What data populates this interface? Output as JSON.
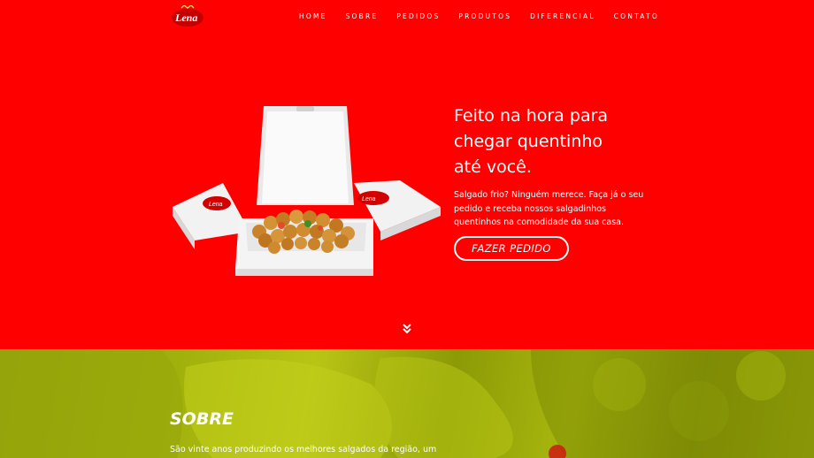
{
  "brand": {
    "logo_text": "Lena",
    "colors": {
      "primary": "#ff0000",
      "olive": "#a1b10c"
    }
  },
  "nav": {
    "items": [
      {
        "label": "HOME"
      },
      {
        "label": "SOBRE"
      },
      {
        "label": "PEDIDOS"
      },
      {
        "label": "PRODUTOS"
      },
      {
        "label": "DIFERENCIAL"
      },
      {
        "label": "CONTATO"
      }
    ]
  },
  "hero": {
    "title_line1": "Feito na hora para",
    "title_line2": "chegar quentinho",
    "title_line3": "até você.",
    "description": "Salgado frio? Ninguém merece. Faça já o seu pedido e receba nossos salgadinhos quentinhos na comodidade da sua casa.",
    "cta_label": "FAZER PEDIDO",
    "scroll_icon": "double-chevron-down-icon"
  },
  "about": {
    "title": "SOBRE",
    "text": "São vinte anos produzindo os melhores salgados da região, um"
  }
}
